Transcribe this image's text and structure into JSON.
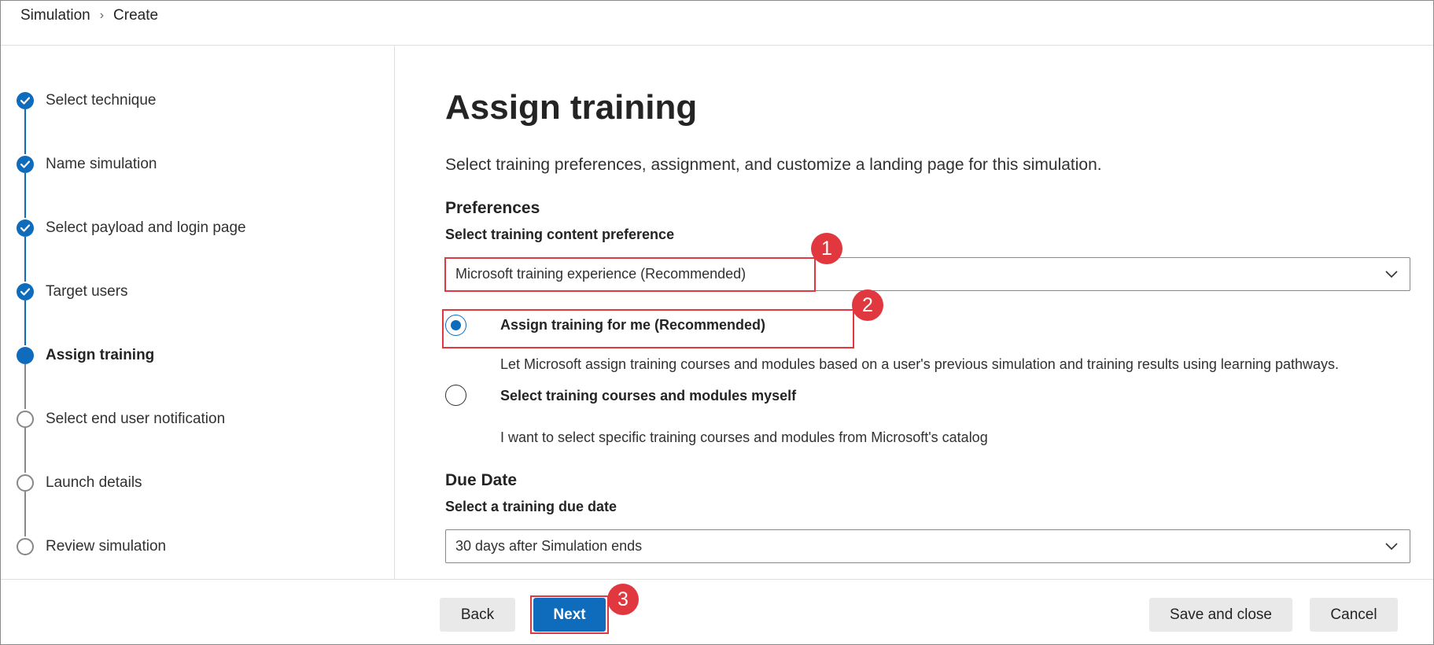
{
  "breadcrumb": {
    "root": "Simulation",
    "current": "Create"
  },
  "steps": [
    {
      "label": "Select technique",
      "state": "done"
    },
    {
      "label": "Name simulation",
      "state": "done"
    },
    {
      "label": "Select payload and login page",
      "state": "done"
    },
    {
      "label": "Target users",
      "state": "done"
    },
    {
      "label": "Assign training",
      "state": "current"
    },
    {
      "label": "Select end user notification",
      "state": "todo"
    },
    {
      "label": "Launch details",
      "state": "todo"
    },
    {
      "label": "Review simulation",
      "state": "todo"
    }
  ],
  "main": {
    "title": "Assign training",
    "description": "Select training preferences, assignment, and customize a landing page for this simulation.",
    "preferences": {
      "heading": "Preferences",
      "content_label": "Select training content preference",
      "content_value": "Microsoft training experience (Recommended)"
    },
    "assignment_options": [
      {
        "label": "Assign training for me (Recommended)",
        "description": "Let Microsoft assign training courses and modules based on a user's previous simulation and training results using learning pathways.",
        "selected": true
      },
      {
        "label": "Select training courses and modules myself",
        "description": "I want to select specific training courses and modules from Microsoft's catalog",
        "selected": false
      }
    ],
    "due_date": {
      "heading": "Due Date",
      "label": "Select a training due date",
      "value": "30 days after Simulation ends"
    }
  },
  "annotations": {
    "badge_1": "1",
    "badge_2": "2",
    "badge_3": "3"
  },
  "footer": {
    "back_label": "Back",
    "next_label": "Next",
    "save_close_label": "Save and close",
    "cancel_label": "Cancel"
  },
  "colors": {
    "accent": "#0f6cbd",
    "annotation_red": "#e0383e",
    "secondary_button": "#e9e9e9"
  }
}
